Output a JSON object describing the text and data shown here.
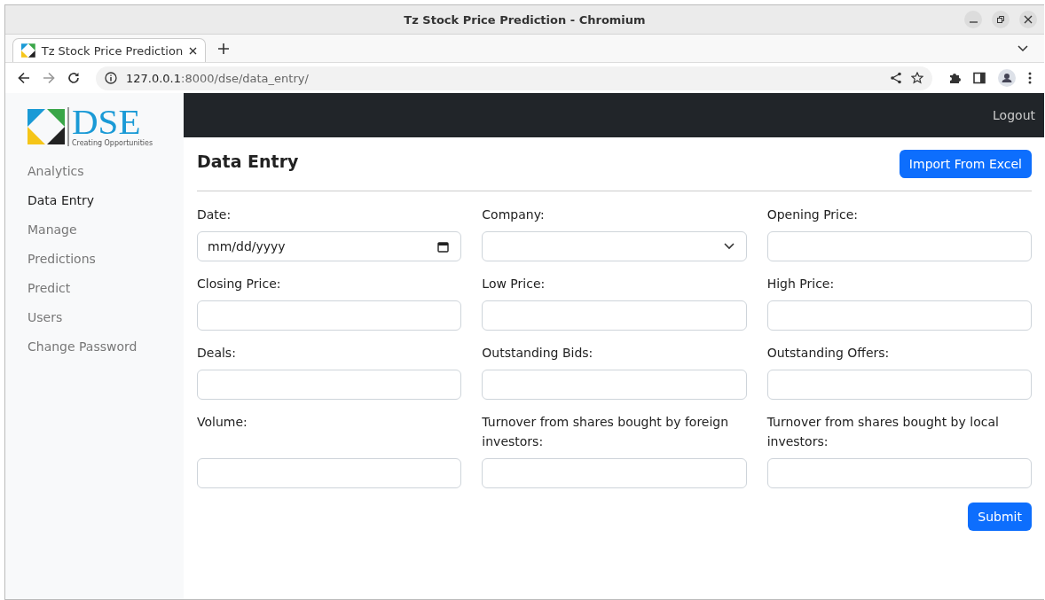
{
  "window": {
    "title": "Tz Stock Price Prediction - Chromium"
  },
  "tabs": [
    {
      "label": "Tz Stock Price Prediction",
      "selected": true
    }
  ],
  "address_bar": {
    "host": "127.0.0.1",
    "path": ":8000/dse/data_entry/"
  },
  "logo": {
    "text": "DSE",
    "tagline": "Creating Opportunities"
  },
  "sidebar": {
    "items": [
      {
        "label": "Analytics",
        "selected": false
      },
      {
        "label": "Data Entry",
        "selected": true
      },
      {
        "label": "Manage",
        "selected": false
      },
      {
        "label": "Predictions",
        "selected": false
      },
      {
        "label": "Predict",
        "selected": false
      },
      {
        "label": "Users",
        "selected": false
      },
      {
        "label": "Change Password",
        "selected": false
      }
    ]
  },
  "navbar": {
    "logout": "Logout"
  },
  "page": {
    "title": "Data Entry",
    "import_button": "Import From Excel"
  },
  "fields": [
    {
      "label": "Date:",
      "kind": "date",
      "placeholder": "mm/dd/yyyy"
    },
    {
      "label": "Company:",
      "kind": "select"
    },
    {
      "label": "Opening Price:",
      "kind": "text"
    },
    {
      "label": "Closing Price:",
      "kind": "text"
    },
    {
      "label": "Low Price:",
      "kind": "text"
    },
    {
      "label": "High Price:",
      "kind": "text"
    },
    {
      "label": "Deals:",
      "kind": "text"
    },
    {
      "label": "Outstanding Bids:",
      "kind": "text"
    },
    {
      "label": "Outstanding Offers:",
      "kind": "text"
    },
    {
      "label": "Volume:",
      "kind": "text"
    },
    {
      "label": "Turnover from shares bought by foreign investors:",
      "kind": "text"
    },
    {
      "label": "Turnover from shares bought by local investors:",
      "kind": "text"
    }
  ],
  "submit_button": "Submit"
}
